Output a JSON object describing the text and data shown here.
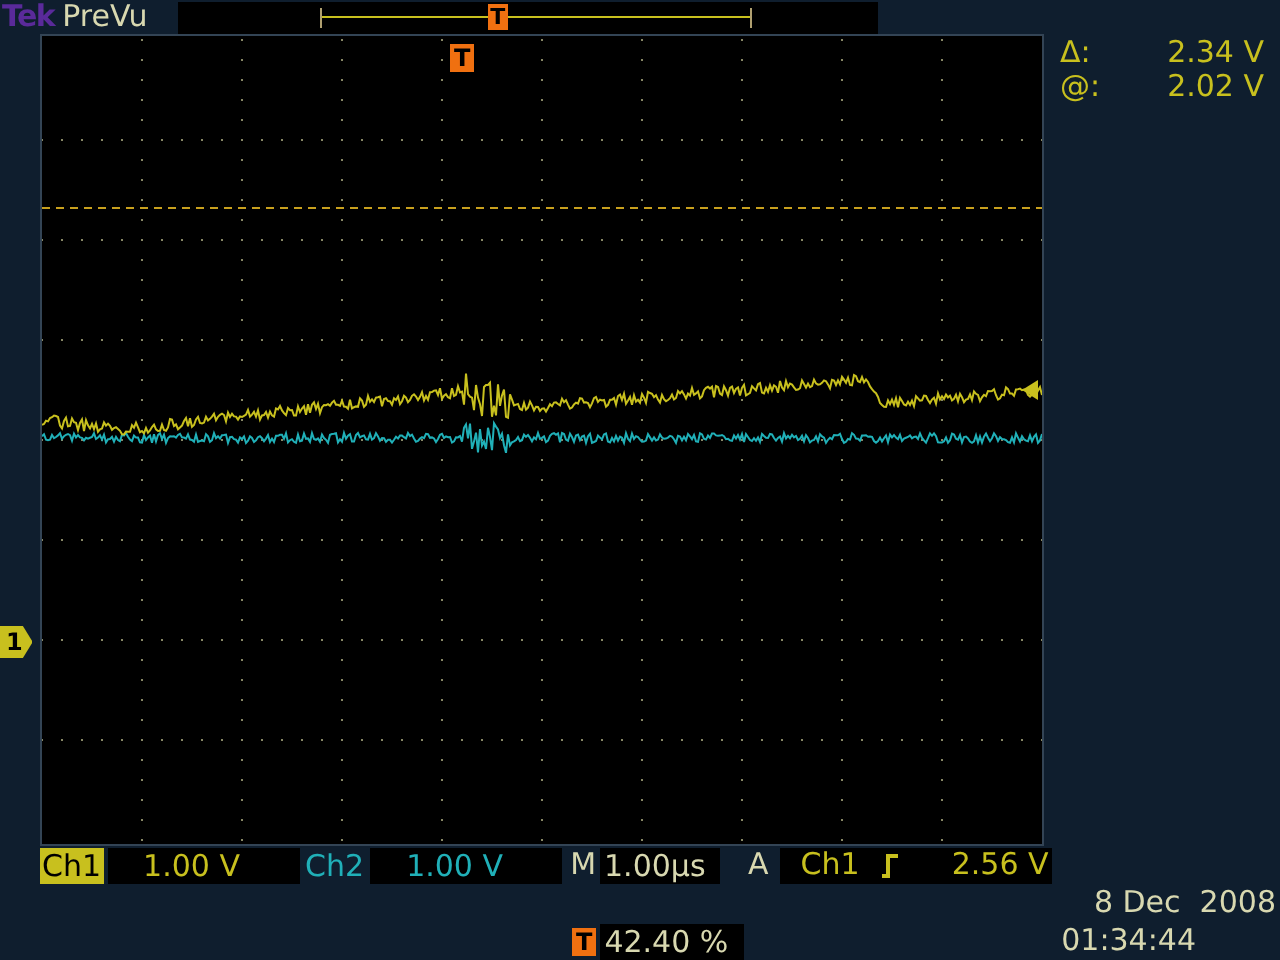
{
  "header": {
    "logo": "Tek",
    "mode": "PreVu",
    "record_trigger": "T"
  },
  "graticule": {
    "trigger_label": "T",
    "channel_marker": "1"
  },
  "cursor_readout": [
    {
      "symbol": "Δ:",
      "value": "2.34 V"
    },
    {
      "symbol": "@:",
      "value": "2.02 V"
    }
  ],
  "channels": [
    {
      "name": "Ch1",
      "scale": "1.00 V",
      "color": "#c8c01e",
      "selected": true
    },
    {
      "name": "Ch2",
      "scale": "1.00 V",
      "color": "#20b0b8",
      "selected": false
    }
  ],
  "timebase": {
    "label": "M",
    "value": "1.00µs"
  },
  "trigger": {
    "label": "A",
    "source": "Ch1",
    "kind": "rising",
    "level": "2.56 V"
  },
  "trigger_position": {
    "icon": "T",
    "value": "42.40 %"
  },
  "date": "8 Dec  2008",
  "time": "01:34:44"
}
